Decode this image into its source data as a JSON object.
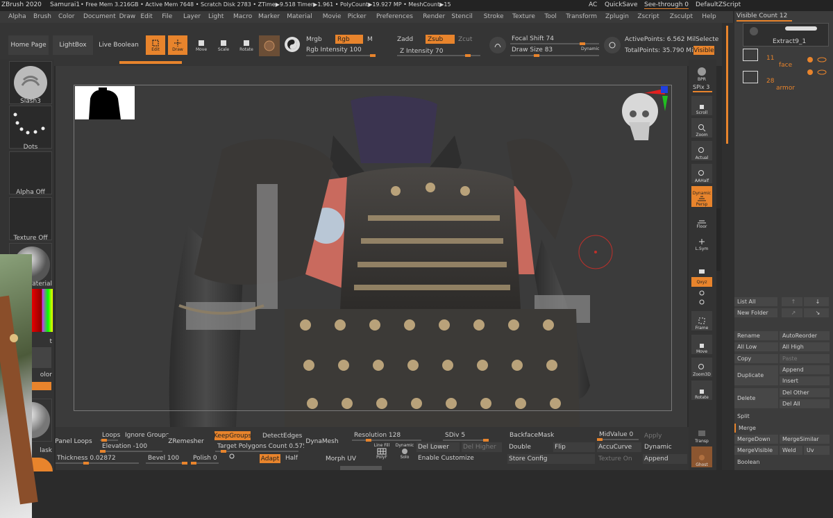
{
  "titlebar": {
    "app": "ZBrush 2020",
    "doc": "Samurai1",
    "stats": "• Free Mem 3.216GB • Active Mem 7648 • Scratch Disk 2783 • ZTime▶9.518 Timer▶1.961 • PolyCount▶19.927 MP • MeshCount▶15",
    "ac": "AC",
    "quicksave": "QuickSave",
    "seethrough": "See-through",
    "seethrough_val": "0",
    "script": "DefaultZScript"
  },
  "menu": [
    "Alpha",
    "Brush",
    "Color",
    "Document",
    "Draw",
    "Edit",
    "File",
    "Layer",
    "Light",
    "Macro",
    "Marker",
    "Material",
    "Movie",
    "Picker",
    "Preferences",
    "Render",
    "Stencil",
    "Stroke",
    "Texture",
    "Tool",
    "Transform",
    "Zplugin",
    "Zscript",
    "Zsculpt",
    "Help"
  ],
  "topshelf": {
    "home": "Home Page",
    "lightbox": "LightBox",
    "liveboolean": "Live Boolean",
    "edit": "Edit",
    "draw": "Draw",
    "move": "Move",
    "scale": "Scale",
    "rotate": "Rotate",
    "mrgb": "Mrgb",
    "rgb": "Rgb",
    "m": "M",
    "rgb_intensity": "Rgb Intensity 100",
    "zadd": "Zadd",
    "zsub": "Zsub",
    "zcut": "Zcut",
    "z_intensity": "Z Intensity 70",
    "focal_shift": "Focal Shift 74",
    "draw_size": "Draw Size 83",
    "dynamic": "Dynamic",
    "active_points": "ActivePoints: 6.562 Mil",
    "total_points": "TotalPoints: 35.790 Mil",
    "select": "Selecte",
    "visible": "Visible"
  },
  "leftpanel": {
    "brush": "Slash3",
    "stroke": "Dots",
    "alpha": "Alpha Off",
    "texture": "Texture Off",
    "material": "aterial",
    "gradient": "t",
    "color": "olor",
    "mask": "lask"
  },
  "rightshelf": {
    "bpr": "BPR",
    "spix": "SPix 3",
    "scroll": "Scroll",
    "zoom": "Zoom",
    "actual": "Actual",
    "aahalf": "AAHalf",
    "dynamic": "Dynamic",
    "persp": "Persp",
    "floor": "Floor",
    "lsym": "L.Sym",
    "xyz": "Qxyz",
    "frame": "Frame",
    "move": "Move",
    "zoom3d": "Zoom3D",
    "rotate": "Rotate",
    "transp": "Transp",
    "ghost": "Ghost"
  },
  "subtool": {
    "visible_count": "Visible Count 12",
    "items": [
      {
        "name": "Extract9_1"
      },
      {
        "count": "11",
        "name": "face"
      },
      {
        "count": "28",
        "name": "armor"
      }
    ],
    "list_all": "List All",
    "new_folder": "New Folder",
    "rename": "Rename",
    "autoreorder": "AutoReorder",
    "all_low": "All Low",
    "all_high": "All High",
    "copy": "Copy",
    "paste": "Paste",
    "duplicate": "Duplicate",
    "append": "Append",
    "insert": "Insert",
    "delete": "Delete",
    "del_other": "Del Other",
    "del_all": "Del All",
    "split": "Split",
    "merge": "Merge",
    "mergedown": "MergeDown",
    "mergesimilar": "MergeSimilar",
    "mergevisible": "MergeVisible",
    "weld": "Weld",
    "uv": "Uv",
    "boolean": "Boolean"
  },
  "bottomshelf": {
    "panel_loops": "Panel Loops",
    "loops": "Loops",
    "ignore_groups": "Ignore Groups",
    "elevation": "Elevation -100",
    "thickness": "Thickness 0.02872",
    "bevel": "Bevel 100",
    "polish": "Polish 0",
    "zremesher": "ZRemesher",
    "keepgroups": "KeepGroups",
    "detectedges": "DetectEdges",
    "target": "Target Polygons Count 0.57514",
    "adapt": "Adapt",
    "half": "Half",
    "dynamesh": "DynaMesh",
    "morphuv": "Morph UV",
    "resolution": "Resolution 128",
    "sdiv": "SDiv 5",
    "linefill": "Line Fill",
    "polyf": "PolyF",
    "dynamic": "Dynamic",
    "solo": "Solo",
    "del_lower": "Del Lower",
    "del_higher": "Del Higher",
    "enable_customize": "Enable Customize",
    "backfacemask": "BackfaceMask",
    "double": "Double",
    "flip": "Flip",
    "store_config": "Store Config",
    "midvalue": "MidValue 0",
    "apply": "Apply",
    "accucurve": "AccuCurve",
    "dynamic2": "Dynamic",
    "texture_on": "Texture On",
    "append": "Append"
  },
  "colors": {
    "accent": "#e8842c",
    "panel": "#353535",
    "viewport": "#3b3b3b"
  }
}
